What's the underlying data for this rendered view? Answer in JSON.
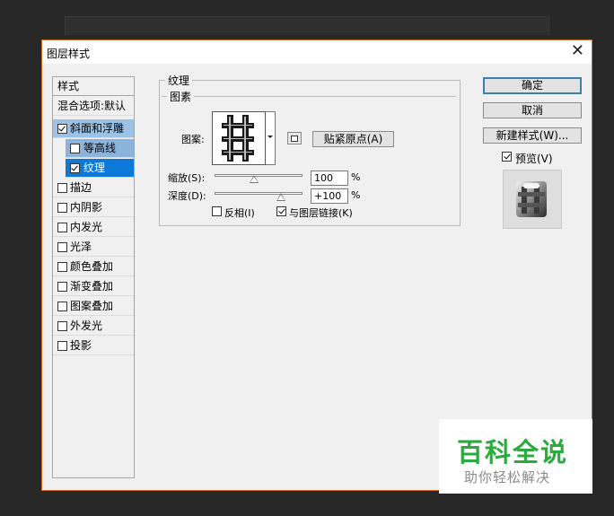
{
  "dialog": {
    "title": "图层样式",
    "close_label": "✕"
  },
  "style_list": {
    "header": "样式",
    "blend_options": "混合选项:默认",
    "items": [
      {
        "label": "斜面和浮雕",
        "checked": true
      },
      {
        "label": "等高线",
        "checked": false
      },
      {
        "label": "纹理",
        "checked": true
      },
      {
        "label": "描边",
        "checked": false
      },
      {
        "label": "内阴影",
        "checked": false
      },
      {
        "label": "内发光",
        "checked": false
      },
      {
        "label": "光泽",
        "checked": false
      },
      {
        "label": "颜色叠加",
        "checked": false
      },
      {
        "label": "渐变叠加",
        "checked": false
      },
      {
        "label": "图案叠加",
        "checked": false
      },
      {
        "label": "外发光",
        "checked": false
      },
      {
        "label": "投影",
        "checked": false
      }
    ]
  },
  "texture": {
    "section_title": "纹理",
    "group_title": "图素",
    "pattern_label": "图案:",
    "snap_origin_button": "贴紧原点(A)",
    "scale": {
      "label": "缩放(S):",
      "value": "100",
      "unit": "%",
      "fraction": 0.45
    },
    "depth": {
      "label": "深度(D):",
      "value": "+100",
      "unit": "%",
      "fraction": 0.75
    },
    "invert": {
      "label": "反相(I)",
      "checked": false
    },
    "link_with_layer": {
      "label": "与图层链接(K)",
      "checked": true
    }
  },
  "buttons": {
    "ok": "确定",
    "cancel": "取消",
    "new_style": "新建样式(W)...",
    "preview_label": "预览(V)",
    "preview_checked": true
  },
  "watermark": {
    "line1": "百科全说",
    "line2": "助你轻松解决"
  }
}
